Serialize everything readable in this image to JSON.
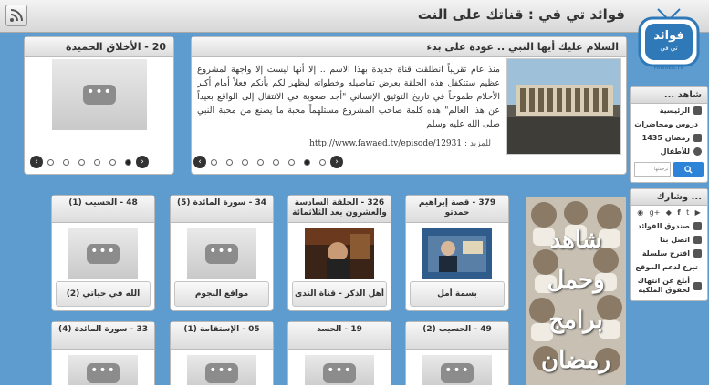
{
  "header": {
    "title": "فوائد تي في : قناتك على النت",
    "logo_text": "فوائد",
    "logo_sub": "تي في",
    "logo_url": "FAWAED.TV"
  },
  "featured": {
    "title": "السلام عليك أيها النبي .. عودة على بدء",
    "body": "منذ عام تقريباً انطلقت قناة جديدة بهذا الاسم .. إلا أنها ليست إلا واجهة لمشروع عظيم ستتكفل هذه الحلقة بعرض تفاصيله وخطواته ليظهر لكم بأنكم فعلاً أمام أكبر الأحلام طموحاً في تاريخ التوثيق الإنساني \"أجد صعوبة في الانتقال إلى الواقع بعيداً عن هذا العالم\" هذه كلمة صاحب المشروع مستلهماً محبة ما يصنع من محبة النبي صلى الله عليه وسلم",
    "more_label": "للمزيد :",
    "link": "http://www.fawaed.tv/episode/12931"
  },
  "side_featured": {
    "title": "20 - الأخلاق الحميدة"
  },
  "sidebar": {
    "watch_title": "شاهد ...",
    "watch_items": [
      "الرئيسية",
      "دروس ومحاضرات",
      "رمضان 1435",
      "للأطفال"
    ],
    "search_label": "ترجمتها",
    "participate_title": "... وشارك",
    "participate_items": [
      "صندوق الفوائد",
      "اتصل بنا",
      "اقترح سلسلة",
      "تبرع لدعم الموقع",
      "أبلغ عن انتهاك لحقوق الملكية"
    ]
  },
  "ramadan_banner": [
    "شاهد",
    "وحمل",
    "برامج",
    "رمضان"
  ],
  "cards_row1": [
    {
      "title": "379 - قصة إبراهيم حمدتو",
      "footer": "بسمة أمل",
      "img": "person"
    },
    {
      "title": "326 - الحلقة السادسة والعشرون بعد الثلاثمائة",
      "footer": "أهل الذكر - قناة الندى",
      "img": "sheikh"
    },
    {
      "title": "34 - سورة المائدة (5)",
      "footer": "مواقع النجوم",
      "img": "placeholder"
    },
    {
      "title": "48 - الحسيب (1)",
      "footer": "الله في حياتي (2)",
      "img": "placeholder"
    }
  ],
  "cards_row2": [
    {
      "title": "49 - الحسيب (2)"
    },
    {
      "title": "19 - الحسد"
    },
    {
      "title": "05 - الإستقامة (1)"
    },
    {
      "title": "33 - سورة المائدة (4)"
    }
  ],
  "carousel": {
    "arrow_prev": "‹",
    "arrow_next": "›",
    "dot_count": 8,
    "active_dot": 7
  },
  "side_carousel": {
    "dot_count": 6,
    "active_dot": 6
  },
  "more_icon": "•••",
  "colors": {
    "background": "#5e9ccf",
    "logo": "#2f79b8"
  }
}
